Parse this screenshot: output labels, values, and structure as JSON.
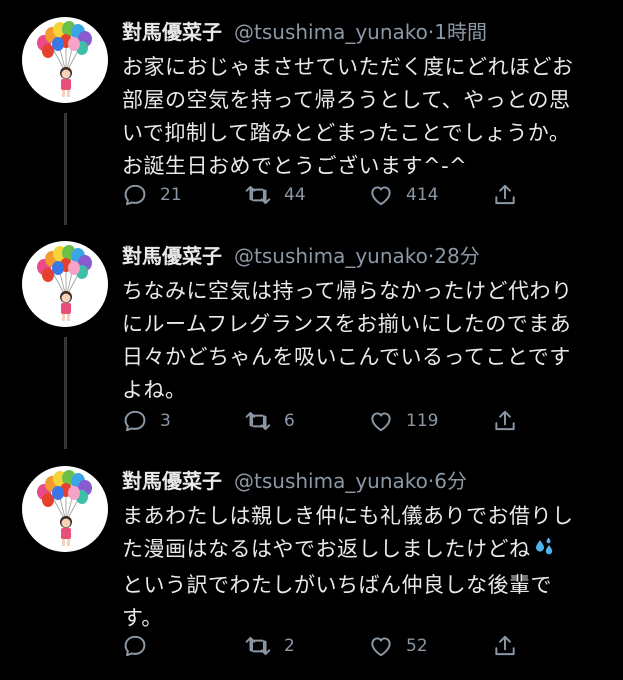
{
  "colors": {
    "background": "#000000",
    "text_primary": "#e7e9ea",
    "text_secondary": "#8b98a5",
    "thread_line": "#333639"
  },
  "icons": {
    "reply": "reply-icon",
    "retweet": "retweet-icon",
    "like": "heart-icon",
    "share": "share-icon"
  },
  "tweets": [
    {
      "name": "對馬優菜子",
      "handle": "@tsushima_yunako",
      "separator": "·",
      "time": "1時間",
      "lines": [
        "お家におじゃまさせていただく度にどれほどお",
        "部屋の空気を持って帰ろうとして、やっとの思",
        "いで抑制して踏みとどまったことでしょうか。",
        "お誕生日おめでとうございます^-^"
      ],
      "replies": "21",
      "retweets": "44",
      "likes": "414"
    },
    {
      "name": "對馬優菜子",
      "handle": "@tsushima_yunako",
      "separator": "·",
      "time": "28分",
      "lines": [
        "ちなみに空気は持って帰らなかったけど代わり",
        "にルームフレグランスをお揃いにしたのでまあ",
        "日々かどちゃんを吸いこんでいるってことです",
        "よね。"
      ],
      "replies": "3",
      "retweets": "6",
      "likes": "119"
    },
    {
      "name": "對馬優菜子",
      "handle": "@tsushima_yunako",
      "separator": "·",
      "time": "6分",
      "lines": [
        "まあわたしは親しき仲にも礼儀ありでお借りし",
        "た漫画はなるはやでお返ししましたけどね",
        "という訳でわたしがいちばん仲良しな後輩で",
        "す。"
      ],
      "replies": "",
      "retweets": "2",
      "likes": "52"
    }
  ]
}
